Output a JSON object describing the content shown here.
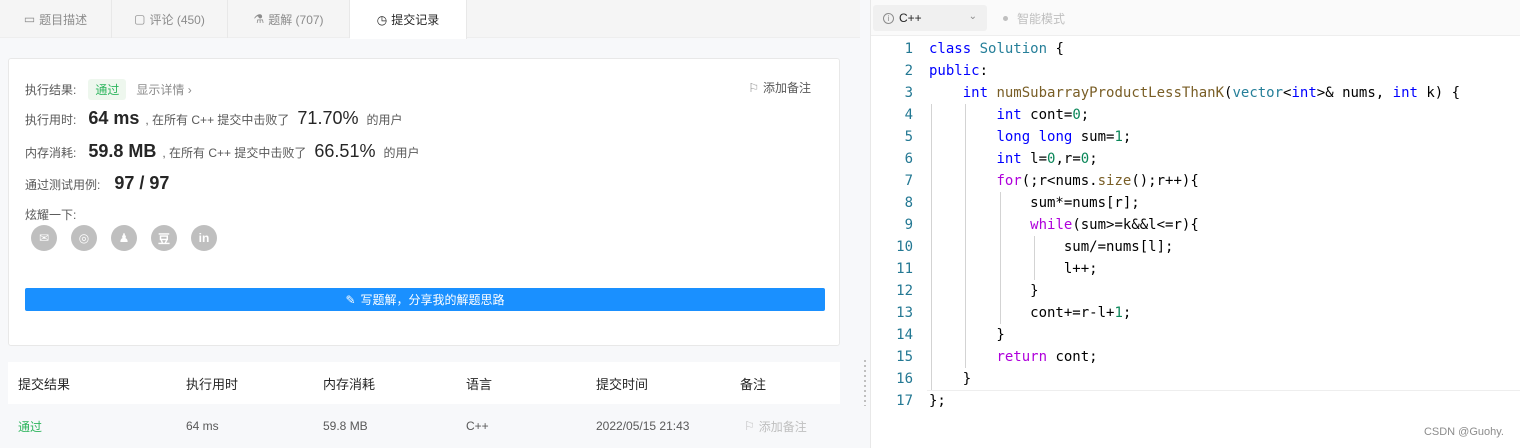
{
  "tabs": [
    {
      "icon": "description-icon",
      "label": "题目描述"
    },
    {
      "icon": "comment-icon",
      "label": "评论 (450)"
    },
    {
      "icon": "flask-icon",
      "label": "题解 (707)"
    },
    {
      "icon": "clock-icon",
      "label": "提交记录"
    }
  ],
  "result": {
    "status_label": "执行结果:",
    "status_value": "通过",
    "detail_link": "显示详情 ›",
    "add_note": "添加备注",
    "runtime_label": "执行用时:",
    "runtime_value": "64 ms",
    "runtime_mid": ", 在所有 C++ 提交中击败了",
    "runtime_pct": "71.70%",
    "runtime_suffix": "的用户",
    "memory_label": "内存消耗:",
    "memory_value": "59.8 MB",
    "memory_mid": ", 在所有 C++ 提交中击败了",
    "memory_pct": "66.51%",
    "memory_suffix": "的用户",
    "tests_label": "通过测试用例:",
    "tests_value": "97 / 97",
    "share_label": "炫耀一下:",
    "share_icons": [
      "wechat-icon",
      "weibo-icon",
      "qq-icon",
      "douban-icon",
      "linkedin-icon"
    ],
    "share_glyphs": [
      "✉",
      "◎",
      "♟",
      "豆",
      "in"
    ],
    "write_button": "写题解，分享我的解题思路"
  },
  "history": {
    "headers": [
      "提交结果",
      "执行用时",
      "内存消耗",
      "语言",
      "提交时间",
      "备注"
    ],
    "row": {
      "result": "通过",
      "runtime": "64 ms",
      "memory": "59.8 MB",
      "lang": "C++",
      "time": "2022/05/15 21:43",
      "note": "添加备注"
    }
  },
  "editor": {
    "language": "C++",
    "smart_mode": "智能模式",
    "line_numbers": [
      "1",
      "2",
      "3",
      "4",
      "5",
      "6",
      "7",
      "8",
      "9",
      "10",
      "11",
      "12",
      "13",
      "14",
      "15",
      "16",
      "17"
    ]
  },
  "watermark": "CSDN @Guohy.",
  "colors": {
    "accent": "#1a90ff",
    "pass": "#2db55d"
  }
}
